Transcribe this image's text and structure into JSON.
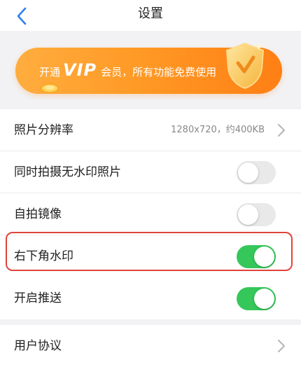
{
  "header": {
    "title": "设置",
    "back_icon": "chevron-left-icon"
  },
  "banner": {
    "prefix": "开通",
    "vip": "VIP",
    "suffix": "会员，所有功能免费使用",
    "gradient_start": "#ffad3f",
    "gradient_end": "#ff7f14"
  },
  "settings": {
    "resolution": {
      "label": "照片分辨率",
      "value": "1280x720，约400KB"
    },
    "no_watermark": {
      "label": "同时拍摄无水印照片",
      "on": false
    },
    "mirror": {
      "label": "自拍镜像",
      "on": false
    },
    "corner_watermark": {
      "label": "右下角水印",
      "on": true
    },
    "push": {
      "label": "开启推送",
      "on": true
    },
    "agreement": {
      "label": "用户协议"
    }
  },
  "colors": {
    "toggle_on": "#35c759",
    "toggle_off": "#e9e9ea",
    "highlight": "#e0433a",
    "background": "#f2f2f4"
  }
}
